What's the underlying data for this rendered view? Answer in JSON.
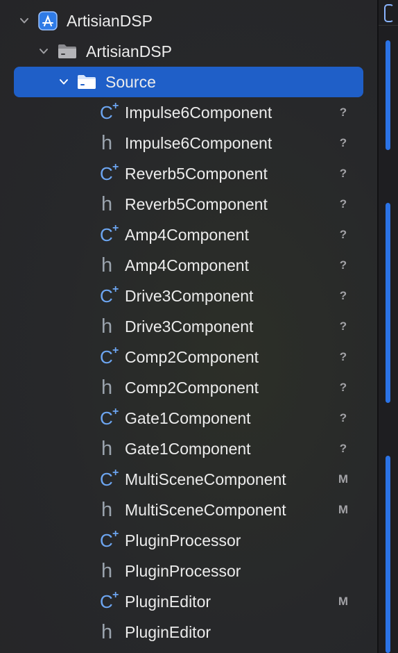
{
  "navigator": {
    "project": {
      "label": "ArtisianDSP",
      "icon": "xcode-project-icon"
    },
    "group": {
      "label": "ArtisianDSP",
      "icon": "folder-icon"
    },
    "selected_group": {
      "label": "Source",
      "icon": "folder-icon"
    },
    "files": [
      {
        "kind": "cpp",
        "name": "Impulse6Component",
        "status": "?"
      },
      {
        "kind": "h",
        "name": "Impulse6Component",
        "status": "?"
      },
      {
        "kind": "cpp",
        "name": "Reverb5Component",
        "status": "?"
      },
      {
        "kind": "h",
        "name": "Reverb5Component",
        "status": "?"
      },
      {
        "kind": "cpp",
        "name": "Amp4Component",
        "status": "?"
      },
      {
        "kind": "h",
        "name": "Amp4Component",
        "status": "?"
      },
      {
        "kind": "cpp",
        "name": "Drive3Component",
        "status": "?"
      },
      {
        "kind": "h",
        "name": "Drive3Component",
        "status": "?"
      },
      {
        "kind": "cpp",
        "name": "Comp2Component",
        "status": "?"
      },
      {
        "kind": "h",
        "name": "Comp2Component",
        "status": "?"
      },
      {
        "kind": "cpp",
        "name": "Gate1Component",
        "status": "?"
      },
      {
        "kind": "h",
        "name": "Gate1Component",
        "status": "?"
      },
      {
        "kind": "cpp",
        "name": "MultiSceneComponent",
        "status": "M"
      },
      {
        "kind": "h",
        "name": "MultiSceneComponent",
        "status": "M"
      },
      {
        "kind": "cpp",
        "name": "PluginProcessor",
        "status": ""
      },
      {
        "kind": "h",
        "name": "PluginProcessor",
        "status": ""
      },
      {
        "kind": "cpp",
        "name": "PluginEditor",
        "status": "M"
      },
      {
        "kind": "h",
        "name": "PluginEditor",
        "status": ""
      }
    ]
  },
  "glyphs": {
    "cpp": "C",
    "cpp_plus": "+",
    "h": "h"
  },
  "colors": {
    "selection": "#1f5fc8",
    "cpp_icon": "#6da6f2",
    "h_icon": "#9aa3ad",
    "minimap": "#2b73e6"
  }
}
